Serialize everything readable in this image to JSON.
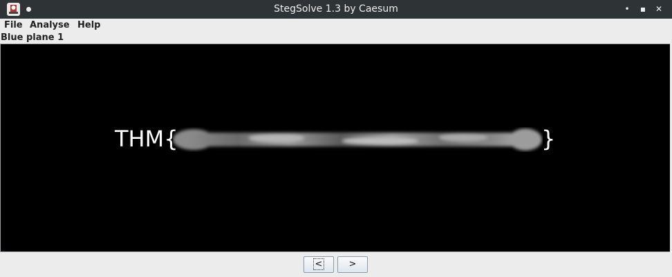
{
  "window": {
    "title": "StegSolve 1.3 by Caesum",
    "controls": {
      "minimize": "•",
      "maximize": "▪",
      "close": "✕"
    }
  },
  "menubar": {
    "items": [
      {
        "label": "File"
      },
      {
        "label": "Analyse"
      },
      {
        "label": "Help"
      }
    ]
  },
  "viewer": {
    "plane_label": "Blue plane 1",
    "flag_prefix": "THM{",
    "flag_suffix": "}",
    "redacted": true
  },
  "navigation": {
    "prev_label": "<",
    "next_label": ">"
  },
  "colors": {
    "titlebar_bg": "#2e3436",
    "window_bg": "#ececec",
    "image_bg": "#000000",
    "flag_text": "#ffffff"
  }
}
